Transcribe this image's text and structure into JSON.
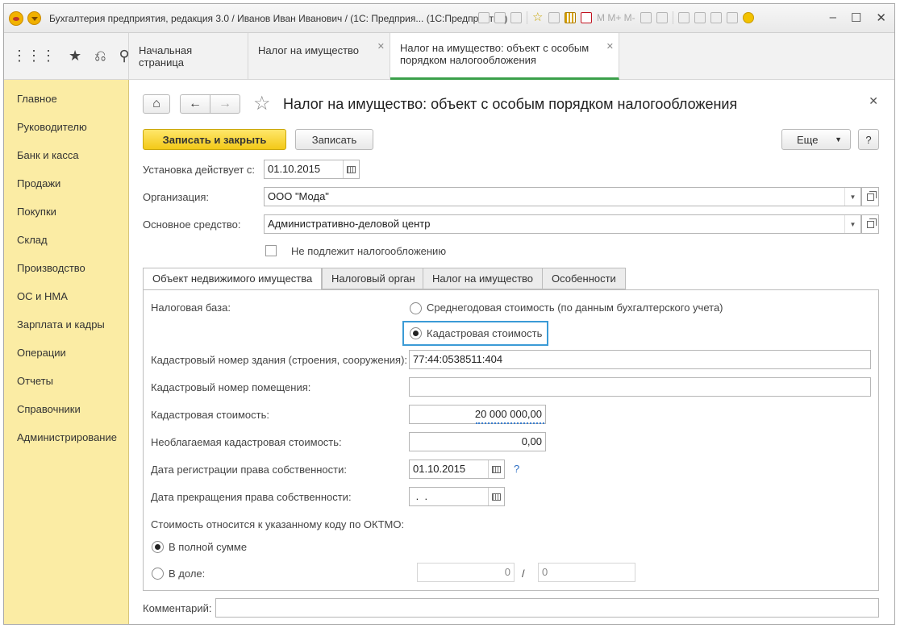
{
  "window": {
    "title": "Бухгалтерия предприятия, редакция 3.0 / Иванов Иван Иванович / (1С: Предприя...  (1С:Предприятие)",
    "toolbar_text": "M  M+  M-"
  },
  "open_tabs": [
    {
      "label": "Начальная страница"
    },
    {
      "label": "Налог на имущество"
    },
    {
      "label": "Налог на имущество: объект с особым порядком налогообложения"
    }
  ],
  "sidebar": {
    "items": [
      {
        "label": "Главное"
      },
      {
        "label": "Руководителю"
      },
      {
        "label": "Банк и касса"
      },
      {
        "label": "Продажи"
      },
      {
        "label": "Покупки"
      },
      {
        "label": "Склад"
      },
      {
        "label": "Производство"
      },
      {
        "label": "ОС и НМА"
      },
      {
        "label": "Зарплата и кадры"
      },
      {
        "label": "Операции"
      },
      {
        "label": "Отчеты"
      },
      {
        "label": "Справочники"
      },
      {
        "label": "Администрирование"
      }
    ]
  },
  "form": {
    "title": "Налог на имущество: объект с особым порядком налогообложения",
    "save_close_label": "Записать и закрыть",
    "save_label": "Записать",
    "more_label": "Еще",
    "help_label": "?",
    "effective_date_label": "Установка действует с:",
    "effective_date": "01.10.2015",
    "organization_label": "Организация:",
    "organization": "ООО \"Мода\"",
    "asset_label": "Основное средство:",
    "asset": "Административно-деловой центр",
    "not_taxable_label": "Не подлежит налогообложению",
    "not_taxable_checked": false
  },
  "inner_tabs": [
    {
      "label": "Объект недвижимого имущества",
      "active": true
    },
    {
      "label": "Налоговый орган",
      "active": false
    },
    {
      "label": "Налог на имущество",
      "active": false
    },
    {
      "label": "Особенности",
      "active": false
    }
  ],
  "property": {
    "tax_base_label": "Налоговая база:",
    "tax_base_option_1": "Среднегодовая стоимость (по данным бухгалтерского учета)",
    "tax_base_option_2": "Кадастровая стоимость",
    "tax_base_selected": 2,
    "building_number_label": "Кадастровый номер здания (строения, сооружения):",
    "building_number": "77:44:0538511:404",
    "room_number_label": "Кадастровый номер помещения:",
    "room_number": "",
    "cadastral_value_label": "Кадастровая стоимость:",
    "cadastral_value": "20 000 000,00",
    "exempt_value_label": "Необлагаемая кадастровая стоимость:",
    "exempt_value": "0,00",
    "reg_date_label": "Дата регистрации права собственности:",
    "reg_date": "01.10.2015",
    "reg_help": "?",
    "end_date_label": "Дата прекращения права собственности:",
    "end_date": " .  .",
    "oktmo_label": "Стоимость относится к указанному коду по ОКТМО:",
    "full_amount_label": "В полной сумме",
    "share_label": "В доле:",
    "share_numerator": "0",
    "share_separator": "/",
    "share_denominator": "0",
    "share_selected": false
  },
  "comment": {
    "label": "Комментарий:",
    "value": ""
  },
  "colors": {
    "sidebar_bg": "#fbeca4",
    "primary_button": "#f3c918",
    "active_tab_underline": "#3aa04a",
    "focus_outline": "#3b9bd6"
  }
}
